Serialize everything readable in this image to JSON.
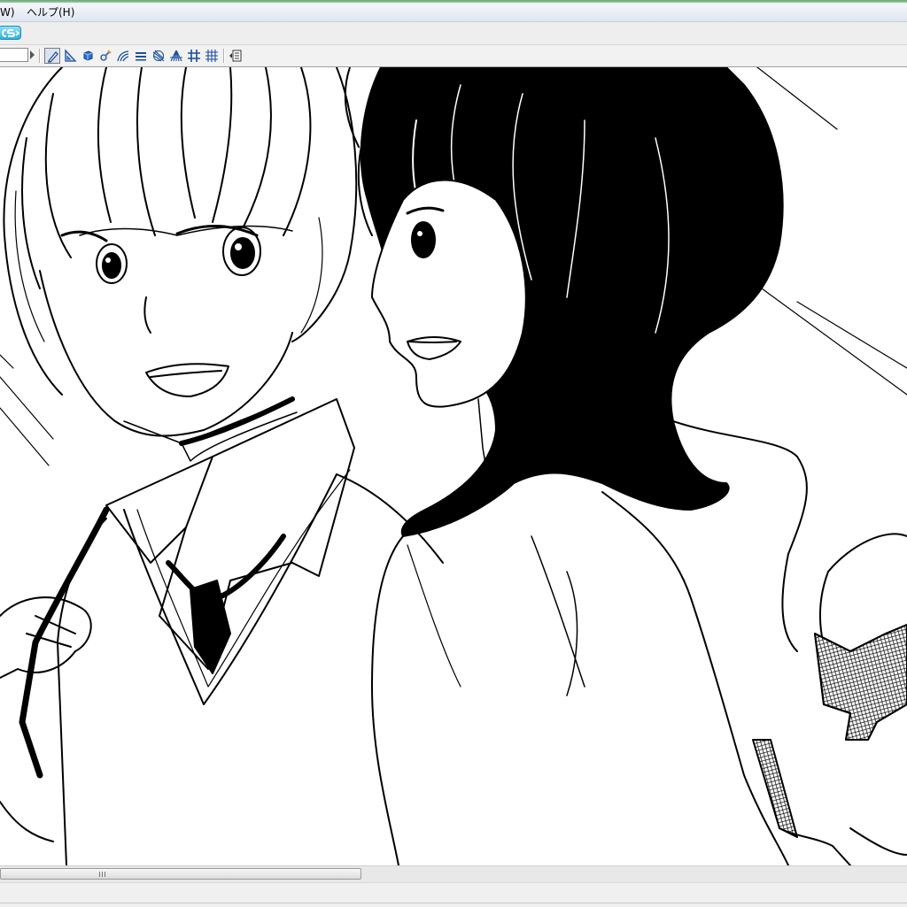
{
  "menubar": {
    "items": [
      {
        "label": "W)"
      },
      {
        "label": "ヘルプ(H)"
      }
    ]
  },
  "toolbar1": {
    "brand_icon": "cs-logo-icon",
    "accent_color": "#2eb0e0"
  },
  "toolbar2": {
    "zoom_value": "",
    "tools": [
      {
        "icon": "pen-tool-icon",
        "active": true
      },
      {
        "icon": "ruler-triangle-icon"
      },
      {
        "icon": "cube-3d-icon"
      },
      {
        "icon": "brush-settings-icon"
      },
      {
        "icon": "curve-ruler-icon"
      },
      {
        "icon": "parallel-lines-ruler-icon"
      },
      {
        "icon": "concentric-ruler-icon"
      },
      {
        "icon": "perspective-ruler-icon"
      },
      {
        "icon": "grid-ruler-icon"
      },
      {
        "icon": "frame-grid-icon"
      },
      {
        "icon": "panel-icon"
      }
    ]
  },
  "canvas": {
    "content": "manga-illustration",
    "background_color": "#ffffff"
  },
  "scrollbar": {
    "position_fraction": 0.0,
    "visible_fraction": 0.4
  }
}
